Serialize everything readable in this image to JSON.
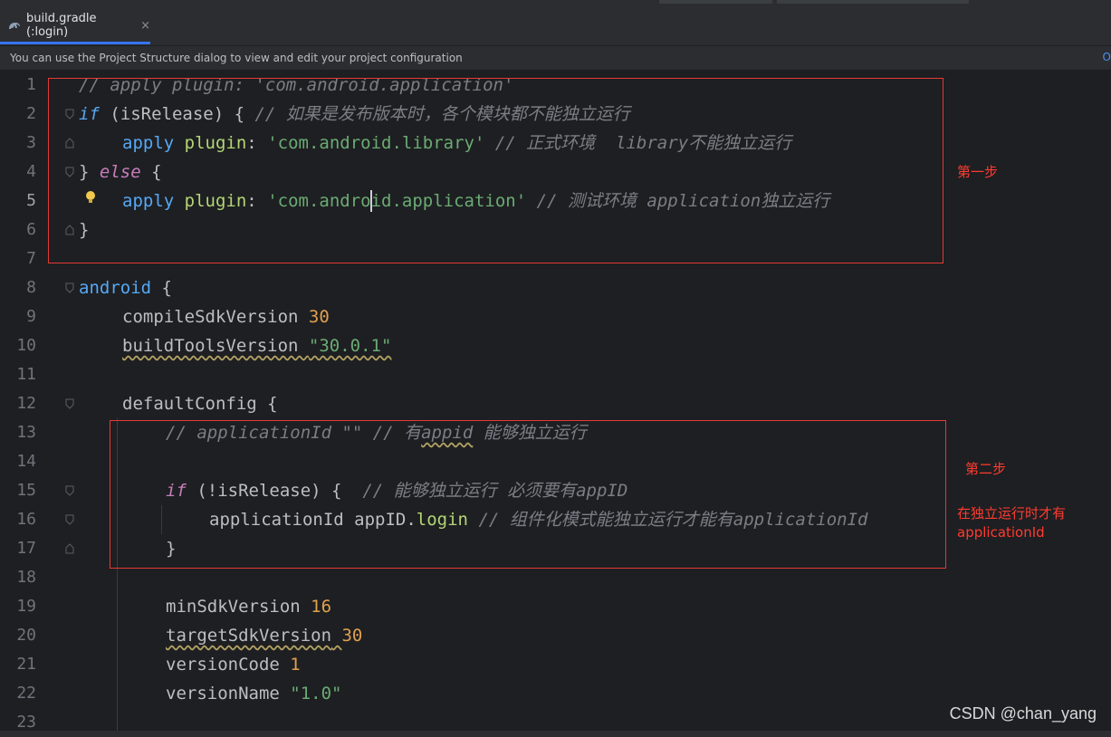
{
  "tab": {
    "title": "build.gradle (:login)",
    "close": "×"
  },
  "notification": {
    "message": "You can use the Project Structure dialog to view and edit your project configuration",
    "edge_text": "O"
  },
  "gutter": [
    "1",
    "2",
    "3",
    "4",
    "5",
    "6",
    "7",
    "8",
    "9",
    "10",
    "11",
    "12",
    "13",
    "14",
    "15",
    "16",
    "17",
    "18",
    "19",
    "20",
    "21",
    "22",
    "23"
  ],
  "current_line": 5,
  "code": {
    "l1": {
      "c1": "// apply plugin: 'com.android.application'"
    },
    "l2": {
      "kw": "if",
      "t1": " (isRelease) { ",
      "c1": "// 如果是发布版本时，各个模块都不能独立运行"
    },
    "l3": {
      "fn": "apply",
      "t1": " ",
      "fn2": "plugin",
      "t2": ": ",
      "str": "'com.android.library'",
      "t3": " ",
      "c1": "// 正式环境  library不能独立运行"
    },
    "l4": {
      "t1": "} ",
      "kw": "else",
      "t2": " {"
    },
    "l5": {
      "fn": "apply",
      "t1": " ",
      "fn2": "plugin",
      "t2": ": ",
      "str": "'com.android.application'",
      "t3": " ",
      "c1": "// 测试环境 application独立运行"
    },
    "l6": {
      "t1": "}"
    },
    "l8": {
      "fn": "android",
      "t1": " {"
    },
    "l9": {
      "t1": "compileSdkVersion ",
      "num": "30"
    },
    "l10": {
      "t1": "buildToolsVersion ",
      "str": "\"30.0.1\""
    },
    "l12": {
      "t1": "defaultConfig {"
    },
    "l13": {
      "c1": "// applicationId \"\" // 有",
      "c2": "appid",
      "c3": " 能够独立运行"
    },
    "l15": {
      "kw": "if",
      "t1": " (!isRelease) {  ",
      "c1": "// 能够独立运行 必须要有appID"
    },
    "l16": {
      "t1": "applicationId appID.",
      "fn": "login",
      "t2": " ",
      "c1": "// 组件化模式能独立运行才能有applicationId"
    },
    "l17": {
      "t1": "}"
    },
    "l19": {
      "t1": "minSdkVersion ",
      "num": "16"
    },
    "l20": {
      "t1": "targetSdkVersion",
      "t2": " ",
      "num": "30"
    },
    "l21": {
      "t1": "versionCode ",
      "num": "1"
    },
    "l22": {
      "t1": "versionName ",
      "str": "\"1.0\""
    }
  },
  "annotations": {
    "step1": "第一步",
    "step2": "第二步",
    "step2_note_line1": "在独立运行时才有",
    "step2_note_line2": "applicationId"
  },
  "watermark": "CSDN @chan_yang",
  "colors": {
    "accent": "#3574f0",
    "annotation": "#ff3b30",
    "keyword": "#cf8e6d",
    "string": "#6aab73",
    "number": "#2aacb8",
    "comment": "#7a7e85",
    "function": "#56a8f5"
  },
  "icons": [
    "gradle-file-icon",
    "close-icon",
    "fold-icon",
    "intention-bulb-icon"
  ]
}
